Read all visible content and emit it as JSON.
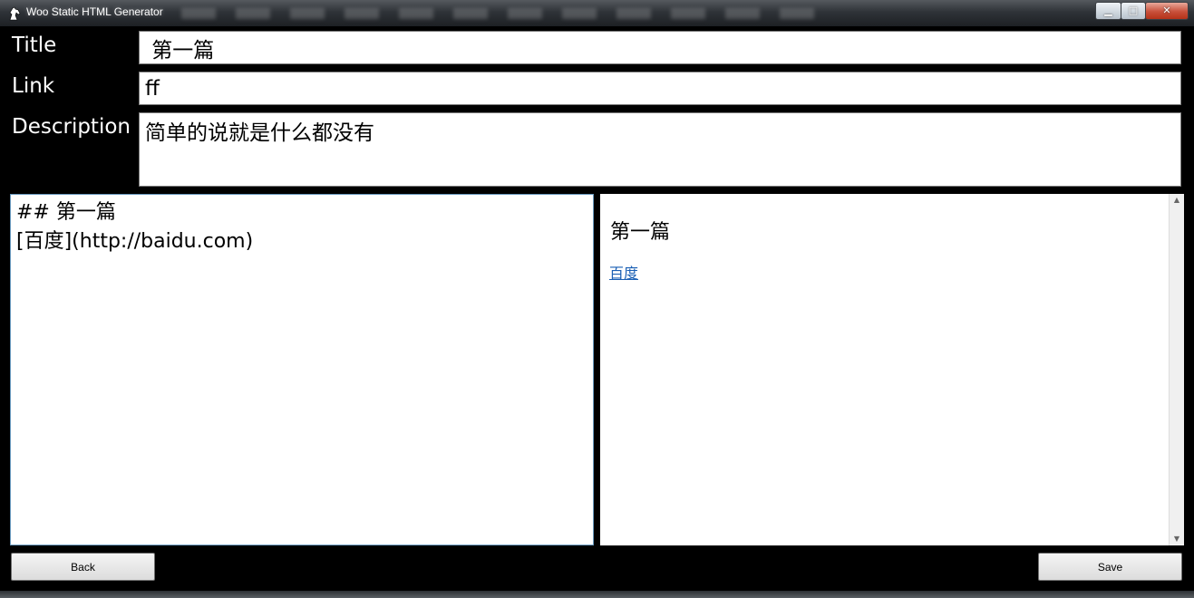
{
  "window": {
    "title": "Woo Static HTML Generator",
    "min_glyph": "▁",
    "max_glyph": "□",
    "close_glyph": "✕"
  },
  "form": {
    "title_label": "Title",
    "title_value": " 第一篇",
    "link_label": "Link",
    "link_value": "ff",
    "description_label": "Description",
    "description_value": "简单的说就是什么都没有"
  },
  "editor": {
    "lines": [
      "## 第一篇",
      "[百度](http://baidu.com)"
    ]
  },
  "preview": {
    "heading": "第一篇",
    "link_text": "百度"
  },
  "buttons": {
    "back_label": "Back",
    "save_label": "Save"
  },
  "icons": {
    "app": "horse-head-icon",
    "scroll_up": "scroll-up-arrow-icon",
    "scroll_down": "scroll-down-arrow-icon"
  }
}
